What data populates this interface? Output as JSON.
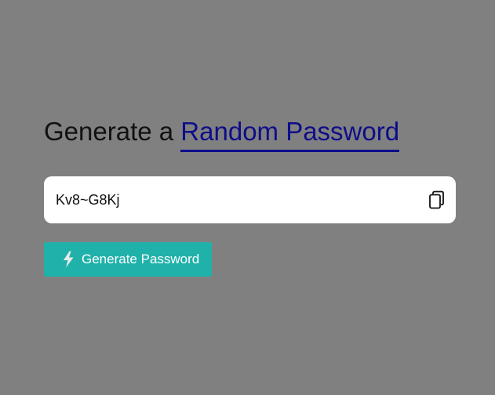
{
  "heading": {
    "prefix": "Generate a",
    "highlight": "Random Password"
  },
  "password_field": {
    "value": "Kv8~G8Kj",
    "copy_icon": "copy-icon"
  },
  "generate_button": {
    "label": "Generate Password",
    "icon": "lightning-bolt-icon"
  },
  "colors": {
    "background": "#808080",
    "accent_text": "#0d0d8a",
    "button": "#20b2aa",
    "field": "#ffffff"
  }
}
